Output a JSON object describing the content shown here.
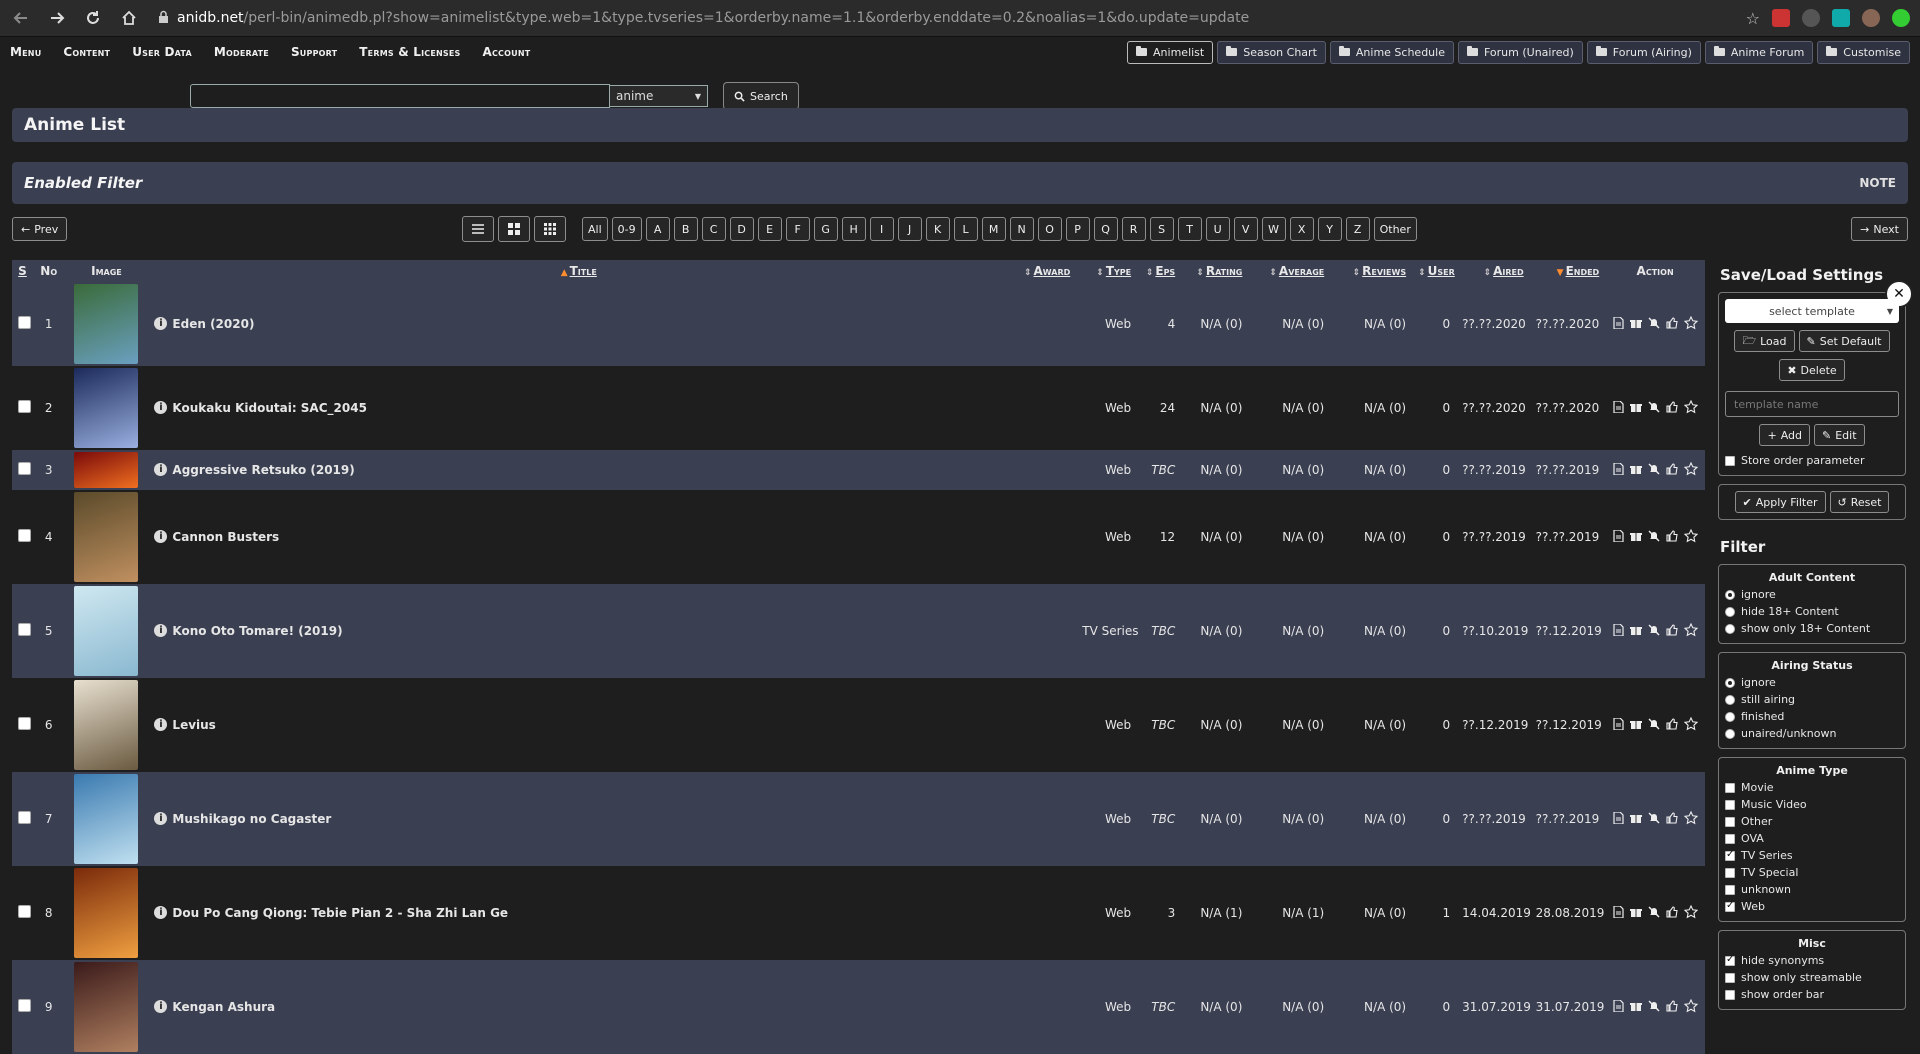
{
  "browser": {
    "url_host": "anidb.net",
    "url_path": "/perl-bin/animedb.pl?show=animelist&type.web=1&type.tvseries=1&orderby.name=1.1&orderby.enddate=0.2&noalias=1&do.update=update"
  },
  "menu": [
    "Menu",
    "Content",
    "User Data",
    "Moderate",
    "Support",
    "Terms & Licenses",
    "Account"
  ],
  "quick_links": [
    "Animelist",
    "Season Chart",
    "Anime Schedule",
    "Forum (Unaired)",
    "Forum (Airing)",
    "Anime Forum",
    "Customise"
  ],
  "search": {
    "value": "",
    "type": "anime",
    "button": "Search"
  },
  "page_title": "Anime List",
  "filter_bar": {
    "title": "Enabled Filter",
    "note": "NOTE"
  },
  "pager": {
    "prev": "Prev",
    "next": "Next"
  },
  "letters": [
    "All",
    "0-9",
    "A",
    "B",
    "C",
    "D",
    "E",
    "F",
    "G",
    "H",
    "I",
    "J",
    "K",
    "L",
    "M",
    "N",
    "O",
    "P",
    "Q",
    "R",
    "S",
    "T",
    "U",
    "V",
    "W",
    "X",
    "Y",
    "Z",
    "Other"
  ],
  "table": {
    "headers": {
      "s": "S",
      "no": "No",
      "image": "Image",
      "title": "Title",
      "award": "Award",
      "type": "Type",
      "eps": "Eps",
      "rating": "Rating",
      "average": "Average",
      "reviews": "Reviews",
      "user": "User",
      "aired": "Aired",
      "ended": "Ended",
      "action": "Action"
    },
    "rows": [
      {
        "no": "1",
        "title": "Eden (2020)",
        "type": "Web",
        "eps": "4",
        "rating": "N/A (0)",
        "average": "N/A (0)",
        "reviews": "N/A (0)",
        "user": "0",
        "aired": "??.??.2020",
        "ended": "??.??.2020"
      },
      {
        "no": "2",
        "title": "Koukaku Kidoutai: SAC_2045",
        "type": "Web",
        "eps": "24",
        "rating": "N/A (0)",
        "average": "N/A (0)",
        "reviews": "N/A (0)",
        "user": "0",
        "aired": "??.??.2020",
        "ended": "??.??.2020"
      },
      {
        "no": "3",
        "title": "Aggressive Retsuko (2019)",
        "type": "Web",
        "eps": "TBC",
        "rating": "N/A (0)",
        "average": "N/A (0)",
        "reviews": "N/A (0)",
        "user": "0",
        "aired": "??.??.2019",
        "ended": "??.??.2019"
      },
      {
        "no": "4",
        "title": "Cannon Busters",
        "type": "Web",
        "eps": "12",
        "rating": "N/A (0)",
        "average": "N/A (0)",
        "reviews": "N/A (0)",
        "user": "0",
        "aired": "??.??.2019",
        "ended": "??.??.2019"
      },
      {
        "no": "5",
        "title": "Kono Oto Tomare! (2019)",
        "type": "TV Series",
        "eps": "TBC",
        "rating": "N/A (0)",
        "average": "N/A (0)",
        "reviews": "N/A (0)",
        "user": "0",
        "aired": "??.10.2019",
        "ended": "??.12.2019"
      },
      {
        "no": "6",
        "title": "Levius",
        "type": "Web",
        "eps": "TBC",
        "rating": "N/A (0)",
        "average": "N/A (0)",
        "reviews": "N/A (0)",
        "user": "0",
        "aired": "??.12.2019",
        "ended": "??.12.2019"
      },
      {
        "no": "7",
        "title": "Mushikago no Cagaster",
        "type": "Web",
        "eps": "TBC",
        "rating": "N/A (0)",
        "average": "N/A (0)",
        "reviews": "N/A (0)",
        "user": "0",
        "aired": "??.??.2019",
        "ended": "??.??.2019"
      },
      {
        "no": "8",
        "title": "Dou Po Cang Qiong: Tebie Pian 2 - Sha Zhi Lan Ge",
        "type": "Web",
        "eps": "3",
        "rating": "N/A (1)",
        "average": "N/A (1)",
        "reviews": "N/A (0)",
        "user": "1",
        "aired": "14.04.2019",
        "ended": "28.08.2019"
      },
      {
        "no": "9",
        "title": "Kengan Ashura",
        "type": "Web",
        "eps": "TBC",
        "rating": "N/A (0)",
        "average": "N/A (0)",
        "reviews": "N/A (0)",
        "user": "0",
        "aired": "31.07.2019",
        "ended": "31.07.2019"
      }
    ]
  },
  "sidebar": {
    "save_load_title": "Save/Load Settings",
    "template_select": "select template",
    "load": "Load",
    "set_default": "Set Default",
    "delete": "Delete",
    "template_name_placeholder": "template name",
    "add": "Add",
    "edit": "Edit",
    "store_order": "Store order parameter",
    "apply_filter": "Apply Filter",
    "reset": "Reset",
    "filter_title": "Filter",
    "adult": {
      "title": "Adult Content",
      "options": [
        "ignore",
        "hide 18+ Content",
        "show only 18+ Content"
      ]
    },
    "airing": {
      "title": "Airing Status",
      "options": [
        "ignore",
        "still airing",
        "finished",
        "unaired/unknown"
      ]
    },
    "anime_type": {
      "title": "Anime Type",
      "options": [
        "Movie",
        "Music Video",
        "Other",
        "OVA",
        "TV Series",
        "TV Special",
        "unknown",
        "Web"
      ]
    },
    "misc": {
      "title": "Misc",
      "options": [
        "hide synonyms",
        "show only streamable",
        "show order bar"
      ]
    }
  },
  "colors": {
    "panel": "#3a3f52",
    "background": "#1e1e1e",
    "sort_active": "#ff8c2e"
  }
}
